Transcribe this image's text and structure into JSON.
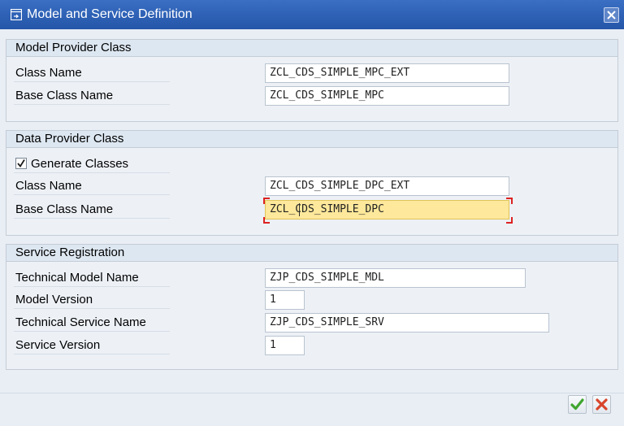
{
  "window": {
    "title": "Model and Service Definition",
    "close_icon": "close-icon"
  },
  "model_provider": {
    "header": "Model Provider Class",
    "class_name_label": "Class Name",
    "class_name_value": "ZCL_CDS_SIMPLE_MPC_EXT",
    "base_class_label": "Base Class Name",
    "base_class_value": "ZCL_CDS_SIMPLE_MPC"
  },
  "data_provider": {
    "header": "Data Provider Class",
    "generate_label": "Generate Classes",
    "generate_checked": true,
    "class_name_label": "Class Name",
    "class_name_value": "ZCL_CDS_SIMPLE_DPC_EXT",
    "base_class_label": "Base Class Name",
    "base_class_value": "ZCL_CDS_SIMPLE_DPC"
  },
  "service_registration": {
    "header": "Service Registration",
    "tech_model_label": "Technical Model Name",
    "tech_model_value": "ZJP_CDS_SIMPLE_MDL",
    "model_version_label": "Model Version",
    "model_version_value": "1",
    "tech_service_label": "Technical Service Name",
    "tech_service_value": "ZJP_CDS_SIMPLE_SRV",
    "service_version_label": "Service Version",
    "service_version_value": "1"
  },
  "footer": {
    "confirm_icon": "checkmark-icon",
    "cancel_icon": "cancel-icon"
  },
  "colors": {
    "titlebar": "#2f63b8",
    "focused_field": "#fde89b",
    "confirm": "#3fa52e",
    "cancel": "#d8452b"
  }
}
